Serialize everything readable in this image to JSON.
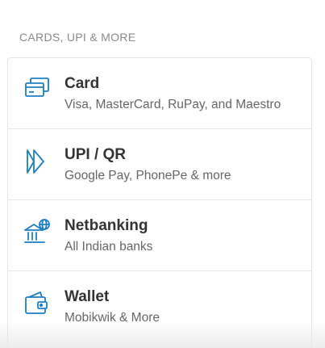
{
  "section": {
    "heading": "CARDS, UPI & MORE"
  },
  "colors": {
    "icon_accent": "#1c7fc2",
    "title": "#333333",
    "subtitle": "#666666",
    "heading": "#8a8a8a"
  },
  "methods": [
    {
      "title": "Card",
      "subtitle": "Visa, MasterCard, RuPay, and Maestro",
      "icon": "card-icon"
    },
    {
      "title": "UPI / QR",
      "subtitle": "Google Pay, PhonePe & more",
      "icon": "upi-icon"
    },
    {
      "title": "Netbanking",
      "subtitle": "All Indian banks",
      "icon": "bank-icon"
    },
    {
      "title": "Wallet",
      "subtitle": "Mobikwik & More",
      "icon": "wallet-icon"
    }
  ]
}
